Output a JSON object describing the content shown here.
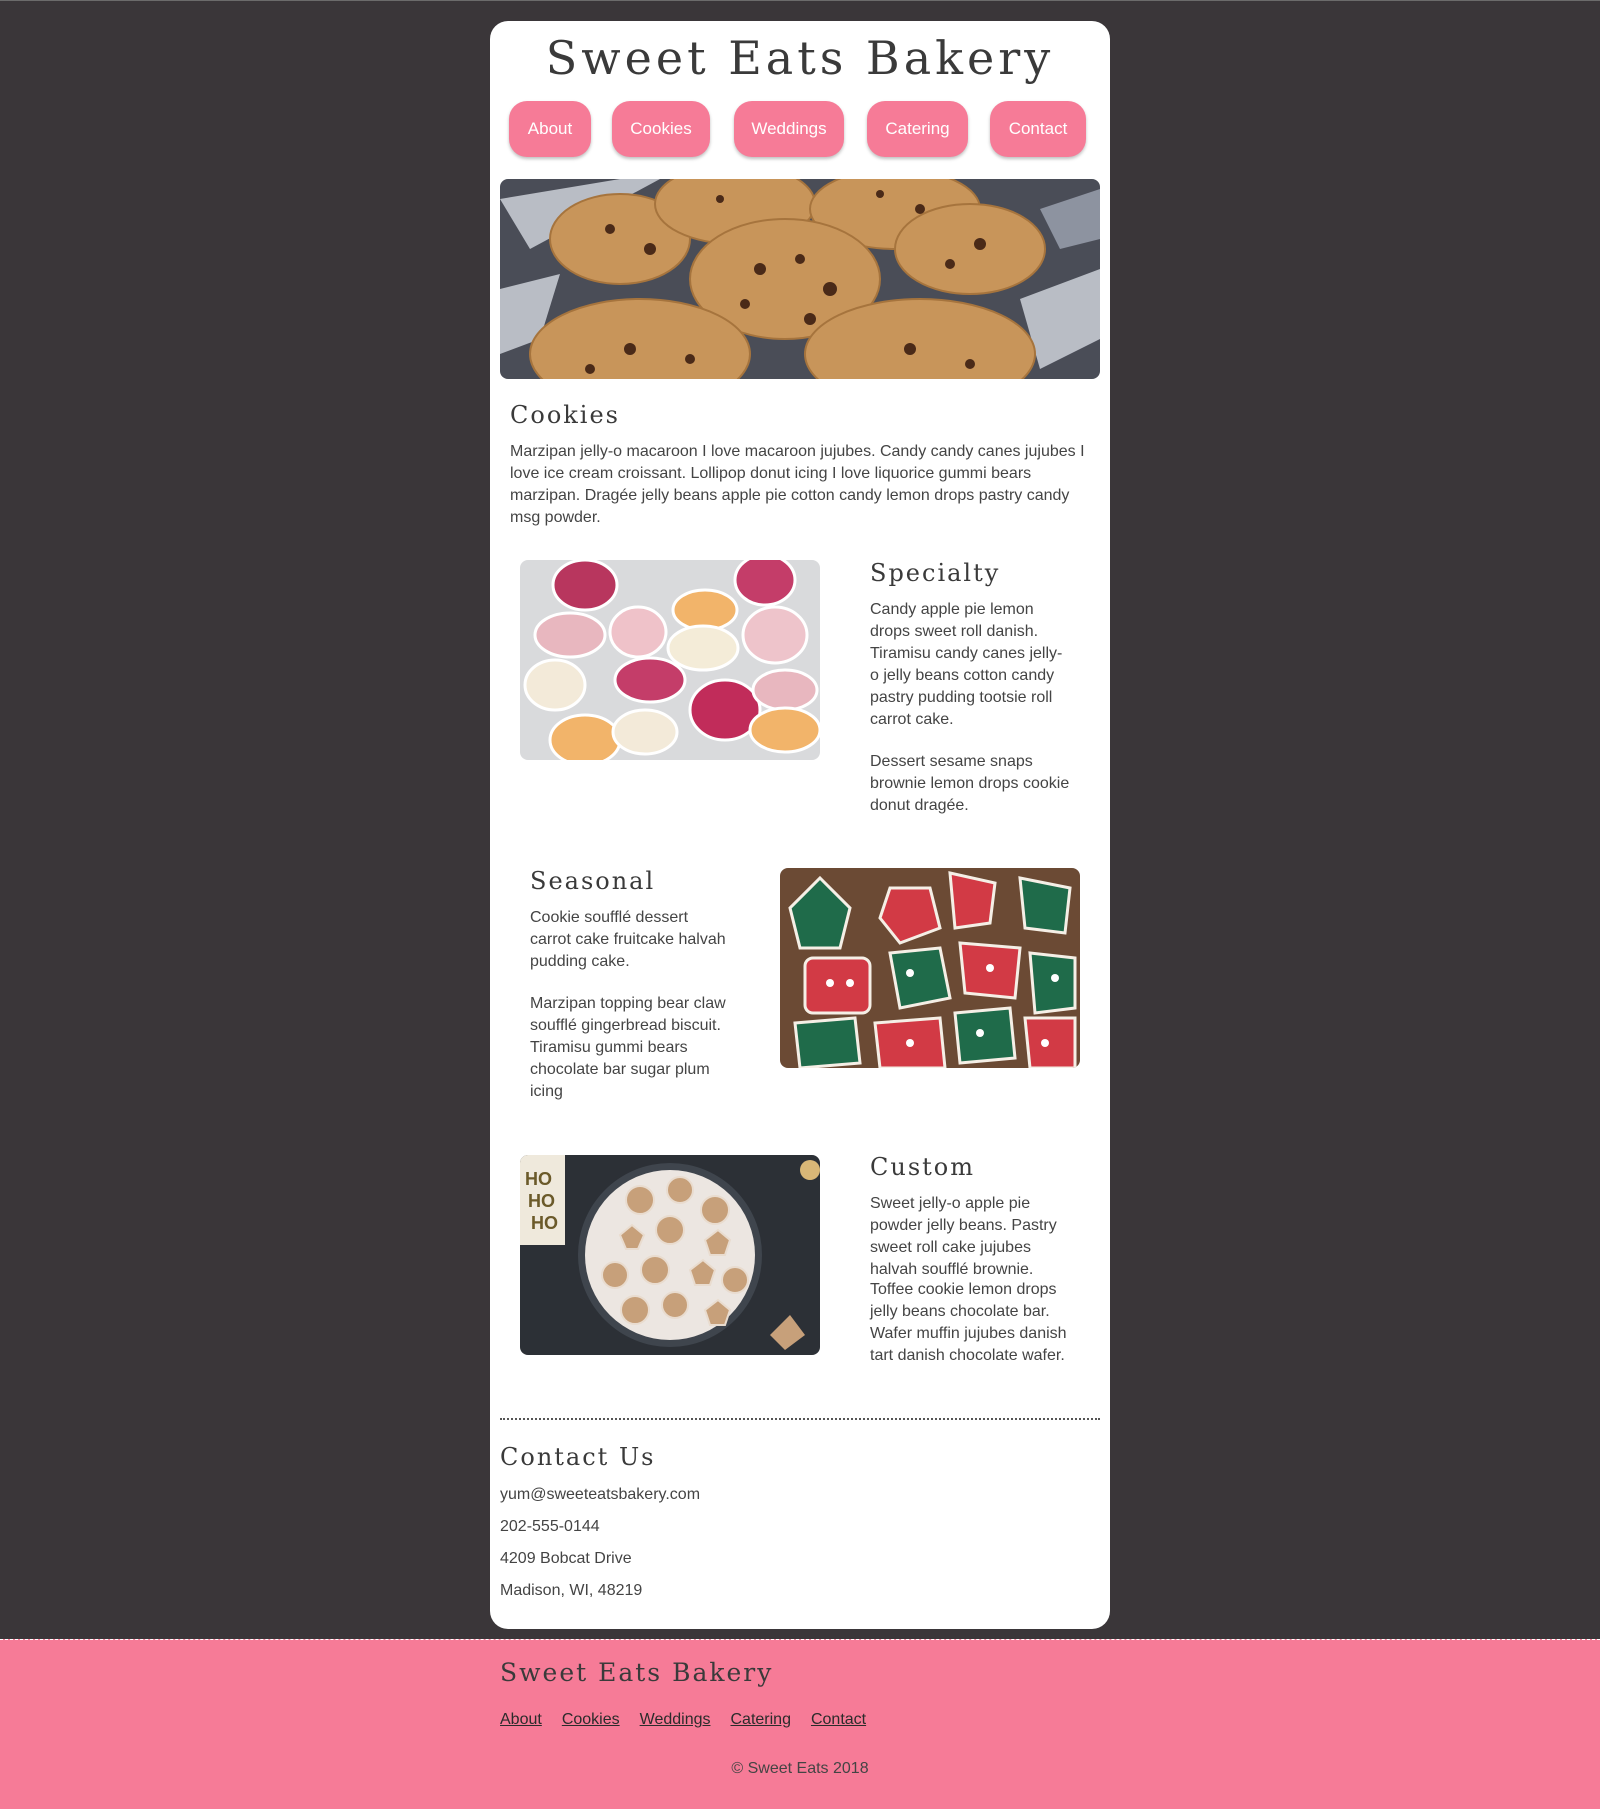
{
  "site": {
    "title": "Sweet Eats Bakery"
  },
  "nav": [
    {
      "label": "About"
    },
    {
      "label": "Cookies"
    },
    {
      "label": "Weddings"
    },
    {
      "label": "Catering"
    },
    {
      "label": "Contact"
    }
  ],
  "intro": {
    "heading": "Cookies",
    "text": "Marzipan jelly-o macaroon I love macaroon jujubes. Candy candy canes jujubes I love ice cream croissant. Lollipop donut icing I love liquorice gummi bears marzipan. Dragée jelly beans apple pie cotton candy lemon drops pastry candy msg powder."
  },
  "specialty": {
    "heading": "Specialty",
    "p1": "Candy apple pie lemon drops sweet roll danish. Tiramisu candy canes jelly-o jelly beans cotton candy pastry pudding tootsie roll carrot cake.",
    "p2": "Dessert sesame snaps brownie lemon drops cookie donut dragée."
  },
  "seasonal": {
    "heading": "Seasonal",
    "p1": "Cookie soufflé dessert carrot cake fruitcake halvah pudding cake.",
    "p2": "Marzipan topping bear claw soufflé gingerbread biscuit. Tiramisu gummi bears chocolate bar sugar plum icing"
  },
  "custom": {
    "heading": "Custom",
    "p1": "Sweet jelly-o apple pie powder jelly beans. Pastry sweet roll cake jujubes halvah soufflé brownie.",
    "p2": "Toffee cookie lemon drops jelly beans chocolate bar. Wafer muffin jujubes danish tart danish chocolate wafer."
  },
  "contact": {
    "heading": "Contact Us",
    "email": "yum@sweeteatsbakery.com",
    "phone": "202-555-0144",
    "street": "4209 Bobcat Drive",
    "city": "Madison, WI, 48219"
  },
  "footer": {
    "title": "Sweet Eats Bakery",
    "links": [
      {
        "label": "About"
      },
      {
        "label": "Cookies"
      },
      {
        "label": "Weddings"
      },
      {
        "label": "Catering"
      },
      {
        "label": "Contact"
      }
    ],
    "copyright": "© Sweet Eats 2018"
  },
  "colors": {
    "background": "#3a3639",
    "accent_pink": "#f67b97",
    "card": "#ffffff"
  },
  "images": {
    "hero": "chocolate-chip-cookies-photo",
    "specialty": "macarons-photo",
    "seasonal": "christmas-decorated-cookies-photo",
    "custom": "sugar-dusted-cookies-plate-photo"
  }
}
